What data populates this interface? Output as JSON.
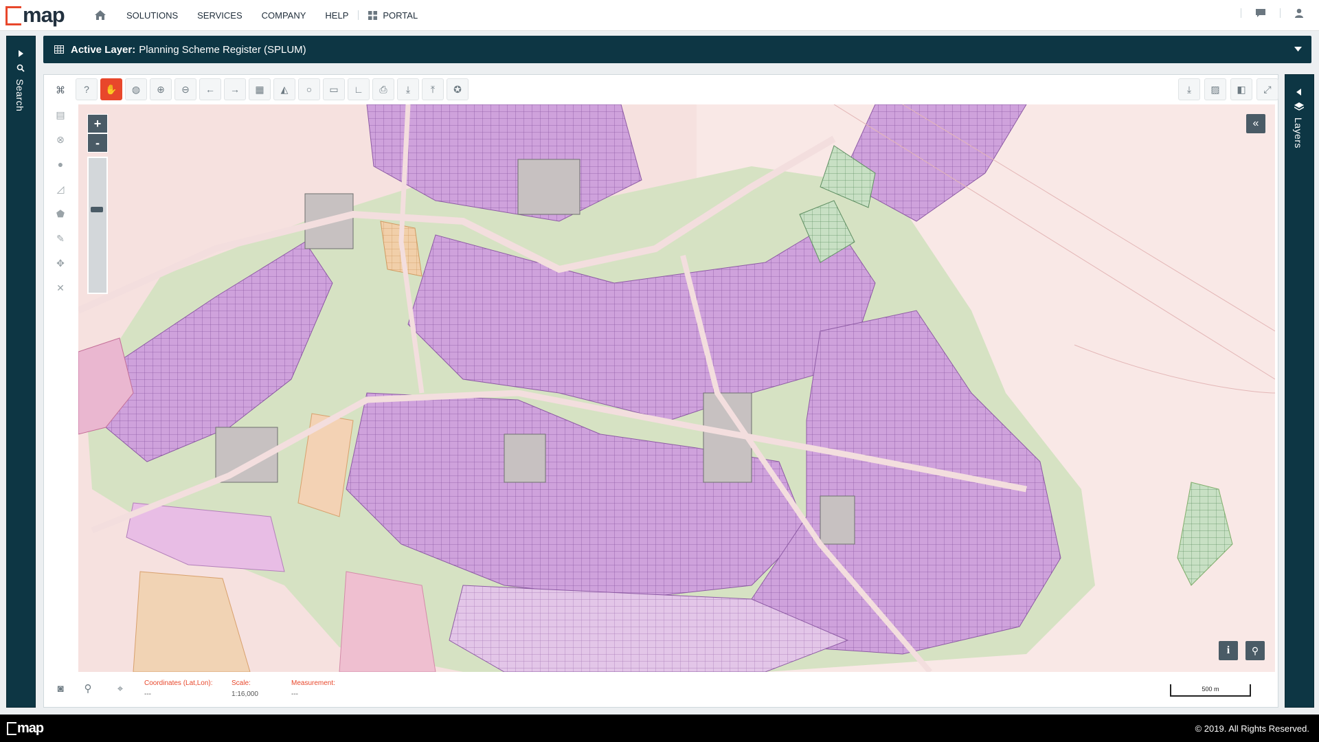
{
  "brand": {
    "logo_text": "map",
    "footer_logo_text": "map",
    "accent": "#e8472b",
    "dark": "#0d3644"
  },
  "nav": {
    "home_icon": "home-icon",
    "items": [
      {
        "label": "SOLUTIONS"
      },
      {
        "label": "SERVICES"
      },
      {
        "label": "COMPANY"
      },
      {
        "label": "HELP"
      }
    ],
    "portal_label": "PORTAL",
    "portal_icon": "grid-icon",
    "right_icons": [
      "chat-icon",
      "user-icon"
    ]
  },
  "left_panel": {
    "label": "Search",
    "icons": [
      "chevron-right-icon",
      "search-icon"
    ]
  },
  "right_panel": {
    "label": "Layers",
    "icons": [
      "chevron-left-icon",
      "layers-icon"
    ]
  },
  "active_layer": {
    "label": "Active Layer:",
    "value": "Planning Scheme Register (SPLUM)",
    "icon": "table-icon",
    "toggle_icon": "chevron-down-icon"
  },
  "toolbar": {
    "tools": [
      "help-icon",
      "pan-hand-icon",
      "globe-icon",
      "zoom-in-icon",
      "zoom-out-icon",
      "back-arrow-icon",
      "forward-arrow-icon",
      "table-icon",
      "profile-chart-icon",
      "circle-icon",
      "ruler-icon",
      "angle-icon",
      "print-icon",
      "download-icon",
      "upload-icon",
      "settings-wheel-icon"
    ],
    "active_tool": "pan-hand-icon",
    "right_tools": [
      "export-icon",
      "image-icon",
      "split-view-icon",
      "fullscreen-icon"
    ]
  },
  "side_tools": [
    "binoculars-icon",
    "map-icon",
    "clear-icon",
    "circle-draw-icon",
    "polyline-icon",
    "polygon-icon",
    "edit-icon",
    "move-icon",
    "delete-icon"
  ],
  "zoom": {
    "plus": "+",
    "minus": "-",
    "level": 0.38
  },
  "map_controls": {
    "collapse": "«",
    "info": "i",
    "attach_icon": "paperclip-icon"
  },
  "status": {
    "coords_label": "Coordinates (Lat,Lon):",
    "coords_value": "---",
    "scale_label": "Scale:",
    "scale_value": "1:16,000",
    "measure_label": "Measurement:",
    "measure_value": "---",
    "scalebar_label": "500 m",
    "icons": [
      "camera-icon",
      "pin-icon",
      "crosshair-icon"
    ]
  },
  "footer": {
    "copyright": "© 2019. All Rights Reserved."
  }
}
